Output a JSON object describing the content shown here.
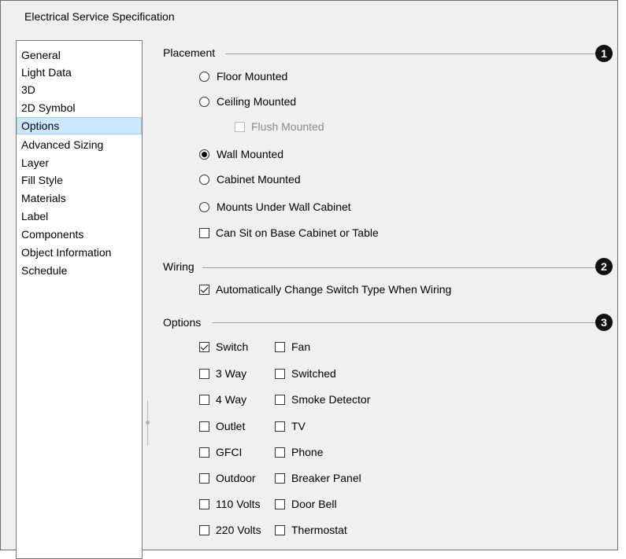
{
  "window": {
    "title": "Electrical Service Specification"
  },
  "sidebar": {
    "items": [
      {
        "label": "General"
      },
      {
        "label": "Light Data"
      },
      {
        "label": "3D"
      },
      {
        "label": "2D Symbol"
      },
      {
        "label": "Options",
        "selected": true
      },
      {
        "label": "Advanced Sizing"
      },
      {
        "label": "Layer"
      },
      {
        "label": "Fill Style"
      },
      {
        "label": "Materials"
      },
      {
        "label": "Label"
      },
      {
        "label": "Components"
      },
      {
        "label": "Object Information"
      },
      {
        "label": "Schedule"
      }
    ]
  },
  "placement": {
    "title": "Placement",
    "badge": "1",
    "floor_mounted": "Floor Mounted",
    "ceiling_mounted": "Ceiling Mounted",
    "flush_mounted": "Flush Mounted",
    "wall_mounted": "Wall Mounted",
    "cabinet_mounted": "Cabinet Mounted",
    "under_wall_cabinet": "Mounts Under Wall Cabinet",
    "can_sit": "Can Sit on Base Cabinet or Table",
    "selected": "Wall Mounted"
  },
  "wiring": {
    "title": "Wiring",
    "badge": "2",
    "auto_change": "Automatically Change Switch Type When Wiring",
    "auto_change_checked": true
  },
  "options": {
    "title": "Options",
    "badge": "3",
    "left": [
      {
        "label": "Switch",
        "checked": true
      },
      {
        "label": "3 Way",
        "checked": false
      },
      {
        "label": "4 Way",
        "checked": false
      },
      {
        "label": "Outlet",
        "checked": false
      },
      {
        "label": "GFCI",
        "checked": false
      },
      {
        "label": "Outdoor",
        "checked": false
      },
      {
        "label": "110 Volts",
        "checked": false
      },
      {
        "label": "220 Volts",
        "checked": false
      }
    ],
    "right": [
      {
        "label": "Fan",
        "checked": false
      },
      {
        "label": "Switched",
        "checked": false
      },
      {
        "label": "Smoke Detector",
        "checked": false
      },
      {
        "label": "TV",
        "checked": false
      },
      {
        "label": "Phone",
        "checked": false
      },
      {
        "label": "Breaker Panel",
        "checked": false
      },
      {
        "label": "Door Bell",
        "checked": false
      },
      {
        "label": "Thermostat",
        "checked": false
      }
    ]
  }
}
